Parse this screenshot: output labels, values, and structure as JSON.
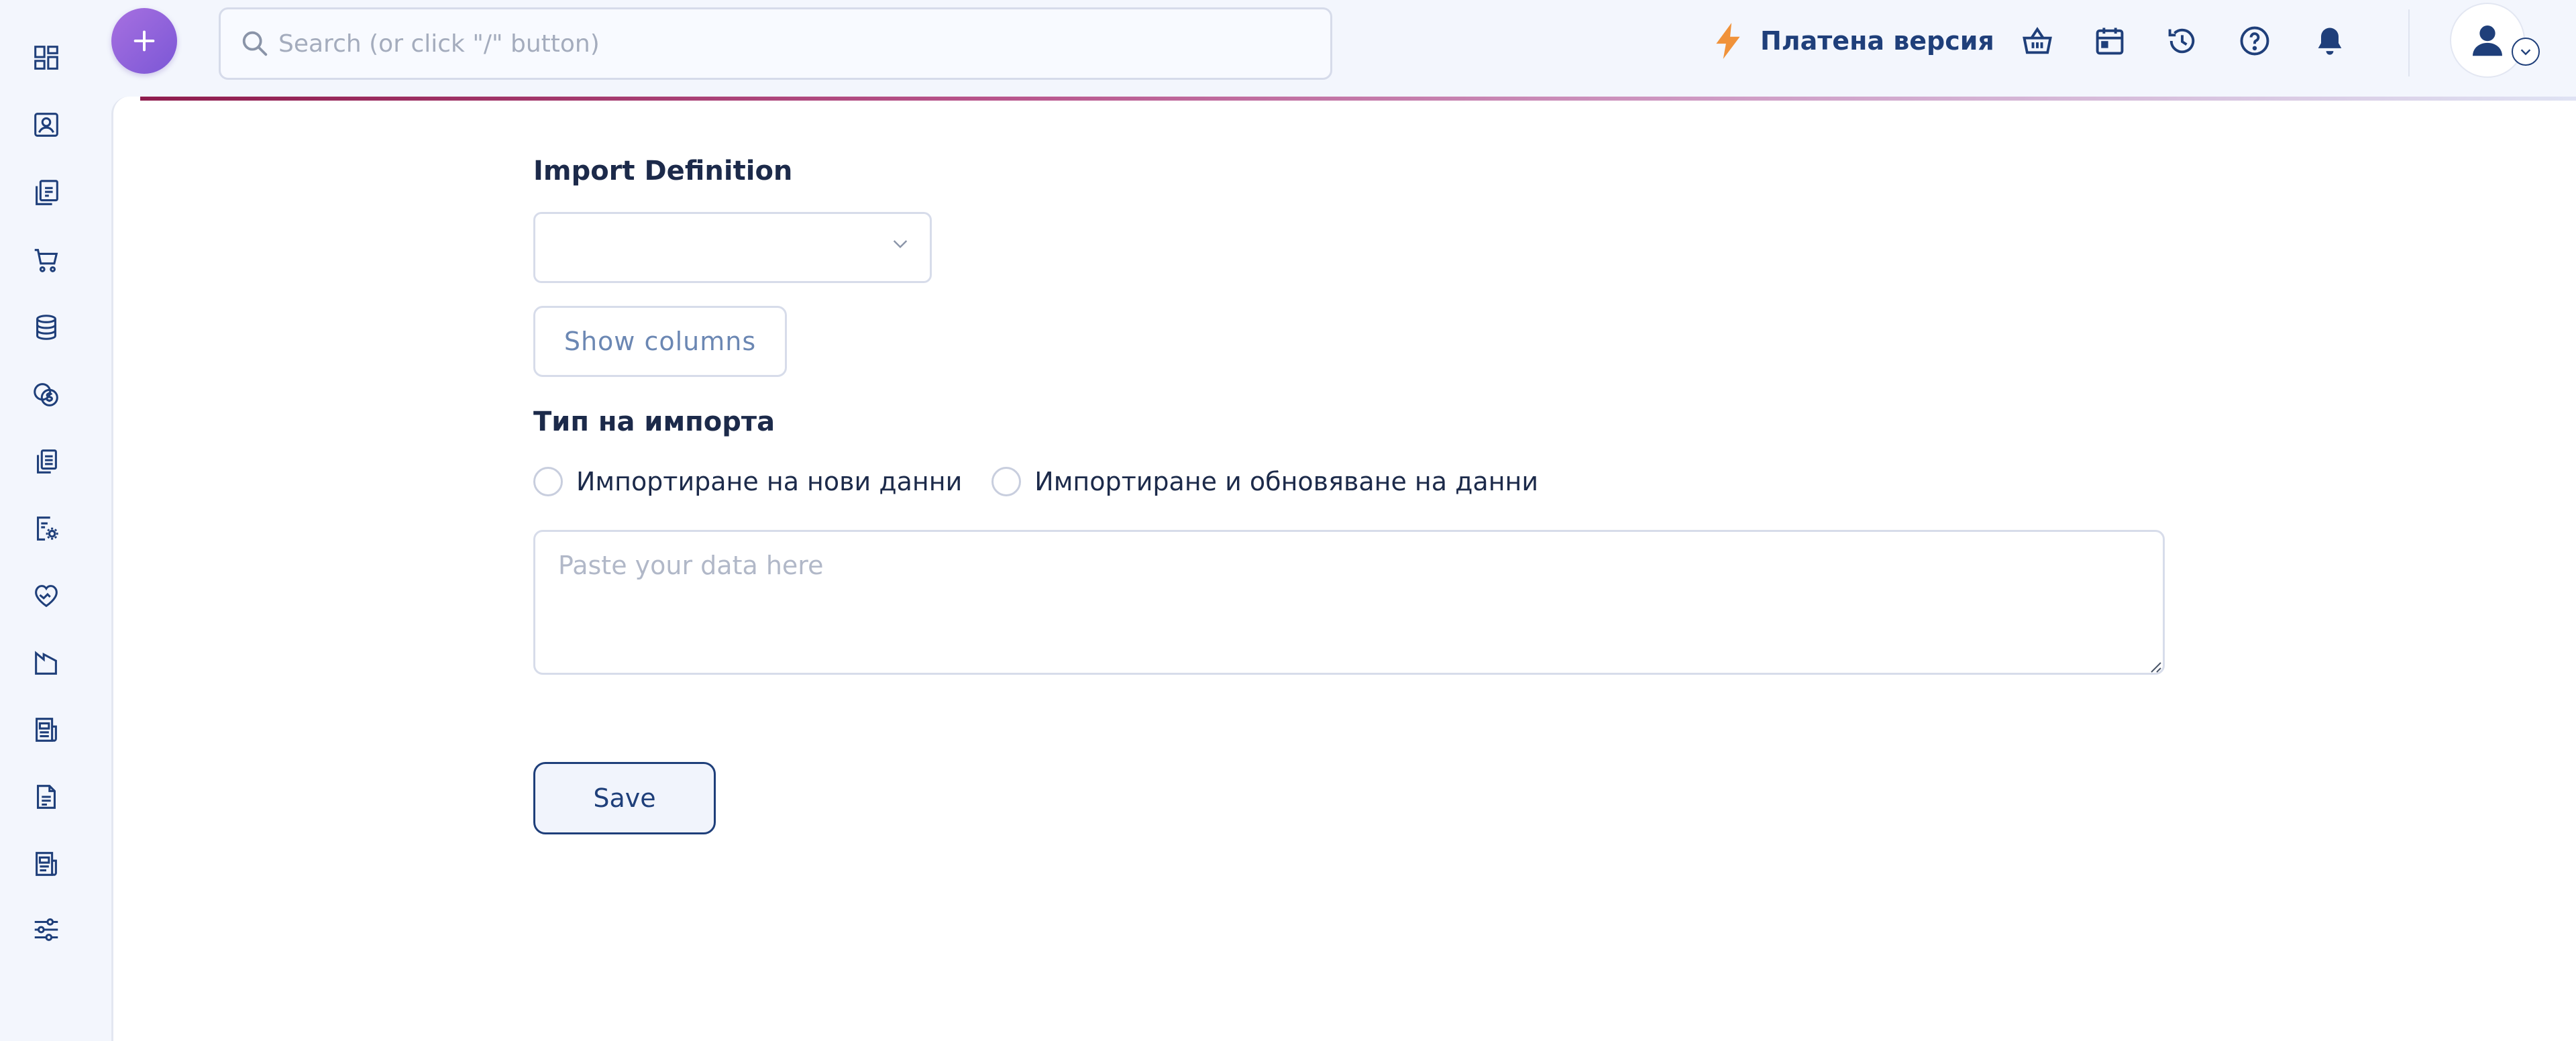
{
  "sidebar": {
    "items": [
      {
        "icon": "dashboard-icon"
      },
      {
        "icon": "contacts-icon"
      },
      {
        "icon": "documents-icon"
      },
      {
        "icon": "cart-icon"
      },
      {
        "icon": "database-icon"
      },
      {
        "icon": "coins-icon"
      },
      {
        "icon": "copy-documents-icon"
      },
      {
        "icon": "document-settings-icon"
      },
      {
        "icon": "heart-hand-icon"
      },
      {
        "icon": "factory-icon"
      },
      {
        "icon": "newspaper-icon"
      },
      {
        "icon": "text-document-icon"
      },
      {
        "icon": "report-icon"
      },
      {
        "icon": "sliders-icon"
      }
    ]
  },
  "header": {
    "search_placeholder": "Search (or click \"/\" button)",
    "paid_version_label": "Платена версия"
  },
  "colors": {
    "accent_navy": "#1f3f7a",
    "fab_purple": "#8e64dc",
    "lightning_orange": "#f0923a",
    "background": "#f3f6fd"
  },
  "form": {
    "import_definition_label": "Import Definition",
    "import_definition_value": "",
    "show_columns_label": "Show columns",
    "import_type_label": "Тип на импорта",
    "import_type_options": [
      {
        "label": "Импортиране на нови данни"
      },
      {
        "label": "Импортиране и обновяване на данни"
      }
    ],
    "data_placeholder": "Paste your data here",
    "save_label": "Save"
  }
}
